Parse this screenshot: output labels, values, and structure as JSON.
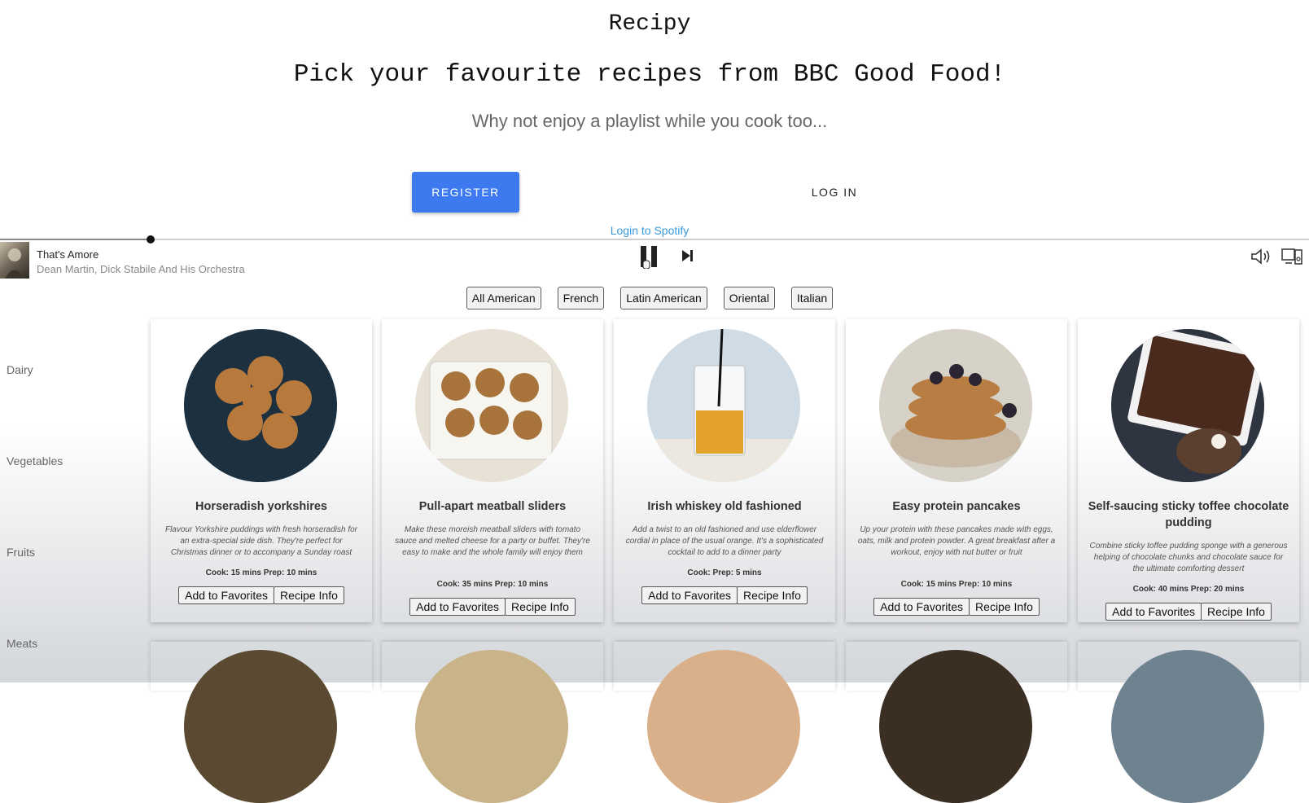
{
  "header": {
    "app_title": "Recipy",
    "tagline": "Pick your favourite recipes from BBC Good Food!",
    "subtitle": "Why not enjoy a playlist while you cook too...",
    "register_label": "REGISTER",
    "login_label": "LOG IN",
    "spotify_link": "Login to Spotify"
  },
  "player": {
    "track_title": "That's Amore",
    "track_artist": "Dean Martin, Dick Stabile And His Orchestra",
    "progress": 0.115,
    "icons": [
      "pause-icon",
      "skip-next-icon",
      "volume-icon",
      "device-icon"
    ]
  },
  "cuisines": [
    "All American",
    "French",
    "Latin American",
    "Oriental",
    "Italian"
  ],
  "categories": [
    "Dairy",
    "Vegetables",
    "Fruits",
    "Meats"
  ],
  "recipes": [
    {
      "title": "Horseradish yorkshires",
      "description": "Flavour Yorkshire puddings with fresh horseradish for an extra-special side dish. They're perfect for Christmas dinner or to accompany a Sunday roast",
      "times": "Cook: 15 mins Prep: 10 mins",
      "favorite_label": "Add to Favorites",
      "info_label": "Recipe Info",
      "image_colors": [
        "#1c3040",
        "#b87a3c"
      ]
    },
    {
      "title": "Pull-apart meatball sliders",
      "description": "Make these moreish meatball sliders with tomato sauce and melted cheese for a party or buffet. They're easy to make and the whole family will enjoy them",
      "times": "Cook: 35 mins Prep: 10 mins",
      "favorite_label": "Add to Favorites",
      "info_label": "Recipe Info",
      "image_colors": [
        "#e8e2d6",
        "#a8743c"
      ]
    },
    {
      "title": "Irish whiskey old fashioned",
      "description": "Add a twist to an old fashioned and use elderflower cordial in place of the usual orange. It's a sophisticated cocktail to add to a dinner party",
      "times": "Cook: Prep: 5 mins",
      "favorite_label": "Add to Favorites",
      "info_label": "Recipe Info",
      "image_colors": [
        "#cfdbe5",
        "#e3a22a"
      ]
    },
    {
      "title": "Easy protein pancakes",
      "description": "Up your protein with these pancakes made with eggs, oats, milk and protein powder. A great breakfast after a workout, enjoy with nut butter or fruit",
      "times": "Cook: 15 mins Prep: 10 mins",
      "favorite_label": "Add to Favorites",
      "info_label": "Recipe Info",
      "image_colors": [
        "#d7d2c8",
        "#b87d42"
      ]
    },
    {
      "title": "Self-saucing sticky toffee chocolate pudding",
      "description": "Combine sticky toffee pudding sponge with a generous helping of chocolate chunks and chocolate sauce for the ultimate comforting dessert",
      "times": "Cook: 40 mins Prep: 20 mins",
      "favorite_label": "Add to Favorites",
      "info_label": "Recipe Info",
      "image_colors": [
        "#2e3440",
        "#4a2a1c"
      ]
    }
  ],
  "next_row_image_colors": [
    "#5a4a32",
    "#c9b48a",
    "#d9b08a",
    "#3b2f24",
    "#6e8290"
  ]
}
